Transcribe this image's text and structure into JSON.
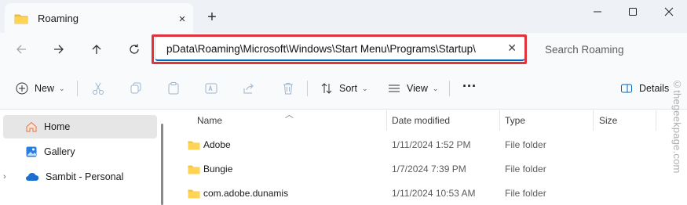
{
  "tab": {
    "title": "Roaming",
    "close_icon": "×",
    "new_tab_icon": "+"
  },
  "window": {
    "minimize": "—",
    "maximize": "☐",
    "close": "✕"
  },
  "address": {
    "path": "pData\\Roaming\\Microsoft\\Windows\\Start Menu\\Programs\\Startup\\",
    "clear_icon": "✕",
    "highlight_color": "#e0343d"
  },
  "search": {
    "placeholder": "Search Roaming"
  },
  "toolbar": {
    "new_label": "New",
    "sort_label": "Sort",
    "view_label": "View",
    "more_label": "···",
    "details_label": "Details"
  },
  "nav": {
    "items": [
      {
        "label": "Home",
        "icon": "home-icon",
        "selected": true
      },
      {
        "label": "Gallery",
        "icon": "gallery-icon",
        "selected": false
      },
      {
        "label": "Sambit - Personal",
        "icon": "cloud-icon",
        "selected": false
      }
    ]
  },
  "columns": {
    "name": "Name",
    "date": "Date modified",
    "type": "Type",
    "size": "Size"
  },
  "rows": [
    {
      "name": "Adobe",
      "date": "1/11/2024 1:52 PM",
      "type": "File folder"
    },
    {
      "name": "Bungie",
      "date": "1/7/2024 7:39 PM",
      "type": "File folder"
    },
    {
      "name": "com.adobe.dunamis",
      "date": "1/11/2024 10:53 AM",
      "type": "File folder"
    }
  ],
  "watermark": "©thegeekpage.com",
  "colors": {
    "accent": "#0067c0",
    "folder": "#f4c542"
  }
}
